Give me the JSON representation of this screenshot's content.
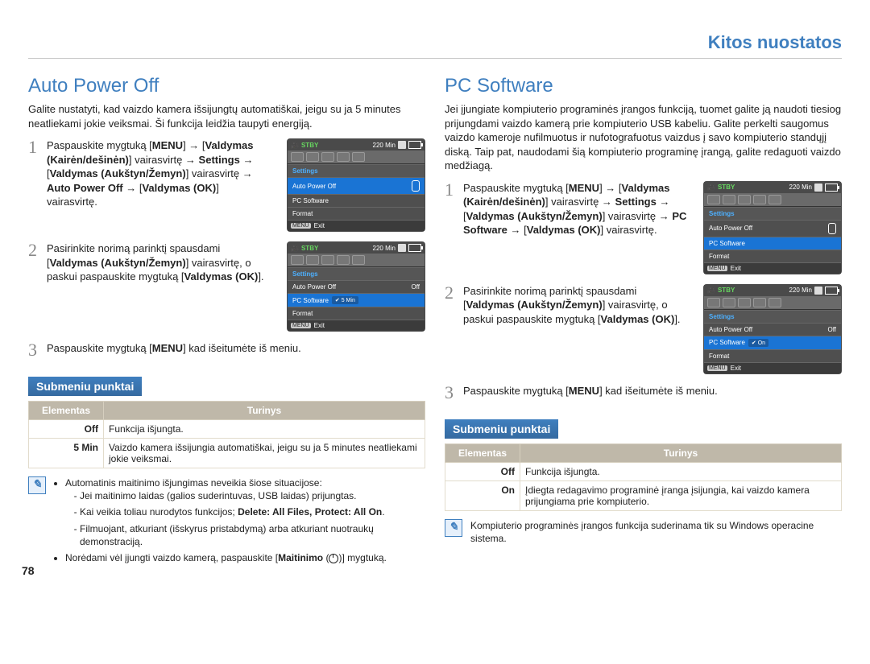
{
  "page": {
    "running_head": "Kitos nuostatos",
    "number": "78"
  },
  "left": {
    "title": "Auto Power Off",
    "intro": "Galite nustatyti, kad vaizdo kamera išsijungtų automatiškai, jeigu su ja 5 minutes neatliekami jokie veiksmai. Ši funkcija leidžia taupyti energiją.",
    "step1_a": "Paspauskite mygtuką [",
    "step1_menu": "MENU",
    "step1_b": "] → [",
    "step1_lr": "Valdymas (Kairėn/dešinėn)",
    "step1_c": "] vairasvirtę → ",
    "step1_settings": "Settings",
    "step1_d": " → [",
    "step1_ud": "Valdymas (Aukštyn/Žemyn)",
    "step1_e": "] vairasvirtę → ",
    "step1_item": "Auto Power Off",
    "step1_f": " → [",
    "step1_ok": "Valdymas (OK)",
    "step1_g": "] vairasvirtę.",
    "step2_a": "Pasirinkite norimą parinktį spausdami [",
    "step2_ud": "Valdymas (Aukštyn/Žemyn)",
    "step2_b": "] vairasvirtę, o paskui paspauskite mygtuką [",
    "step2_ok": "Valdymas (OK)",
    "step2_c": "].",
    "step3_a": "Paspauskite mygtuką [",
    "step3_menu": "MENU",
    "step3_b": "] kad išeitumėte iš meniu.",
    "submenu_title": "Submeniu punktai",
    "th_item": "Elementas",
    "th_desc": "Turinys",
    "row1_item": "Off",
    "row1_desc": "Funkcija išjungta.",
    "row2_item": "5 Min",
    "row2_desc": "Vaizdo kamera išsijungia automatiškai, jeigu su ja 5 minutes neatliekami jokie veiksmai.",
    "note_lead": "Automatinis maitinimo išjungimas neveikia šiose situacijose:",
    "note_s1": "Jei maitinimo laidas (galios suderintuvas, USB laidas) prijungtas.",
    "note_s2a": "Kai veikia toliau nurodytos funkcijos; ",
    "note_s2b": "Delete: All Files, Protect: All On",
    "note_s2c": ".",
    "note_s3": "Filmuojant, atkuriant (išskyrus pristabdymą) arba atkuriant nuotraukų demonstraciją.",
    "note2_a": "Norėdami vėl įjungti vaizdo kamerą, paspauskite [",
    "note2_b": "Maitinimo",
    "note2_c": " (",
    "note2_d": ")] mygtuką."
  },
  "right": {
    "title": "PC Software",
    "intro": "Jei įjungiate kompiuterio programinės įrangos funkciją, tuomet galite ją naudoti tiesiog prijungdami vaizdo kamerą prie kompiuterio USB kabeliu. Galite perkelti saugomus vaizdo kameroje nufilmuotus ir nufotografuotus vaizdus į savo kompiuterio standųjį diską. Taip pat, naudodami šią kompiuterio programinę įrangą, galite redaguoti vaizdo medžiagą.",
    "step1_a": "Paspauskite mygtuką [",
    "step1_menu": "MENU",
    "step1_b": "] → [",
    "step1_lr": "Valdymas (Kairėn/dešinėn)",
    "step1_c": "] vairasvirtę → ",
    "step1_settings": "Settings",
    "step1_d": " → [",
    "step1_ud": "Valdymas (Aukštyn/Žemyn)",
    "step1_e": "] vairasvirtę → ",
    "step1_item": "PC Software",
    "step1_f": " → [",
    "step1_ok": "Valdymas (OK)",
    "step1_g": "] vairasvirtę.",
    "step2_a": "Pasirinkite norimą parinktį spausdami [",
    "step2_ud": "Valdymas (Aukštyn/Žemyn)",
    "step2_b": "] vairasvirtę, o paskui paspauskite mygtuką [",
    "step2_ok": "Valdymas (OK)",
    "step2_c": "].",
    "step3_a": "Paspauskite mygtuką [",
    "step3_menu": "MENU",
    "step3_b": "] kad išeitumėte iš meniu.",
    "submenu_title": "Submeniu punktai",
    "th_item": "Elementas",
    "th_desc": "Turinys",
    "row1_item": "Off",
    "row1_desc": "Funkcija išjungta.",
    "row2_item": "On",
    "row2_desc": "Įdiegta redagavimo programinė įranga įsijungia, kai vaizdo kamera prijungiama prie kompiuterio.",
    "note": "Kompiuterio programinės įrangos funkcija suderinama tik su Windows operacine sistema."
  },
  "screen": {
    "stby": "STBY",
    "mins": "220 Min",
    "settings": "Settings",
    "apo": "Auto Power Off",
    "pcsw": "PC Software",
    "format": "Format",
    "exit": "Exit",
    "menu": "MENU",
    "off": "Off",
    "fivemin": "5 Min",
    "on": "On"
  }
}
